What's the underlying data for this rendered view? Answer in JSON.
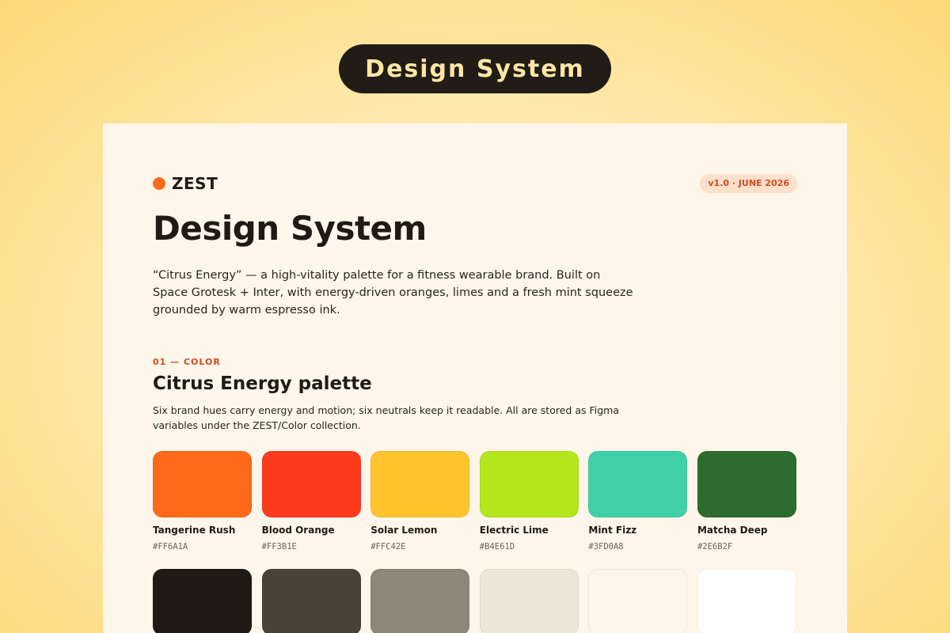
{
  "header_pill": {
    "label": "Design System"
  },
  "brand": {
    "name": "ZEST",
    "dot_color": "#FF6A1A"
  },
  "version_badge": "v1.0 · JUNE 2026",
  "page_title": "Design System",
  "description": "“Citrus Energy” — a high-vitality palette for a fitness wearable brand. Built on Space Grotesk + Inter, with energy-driven oranges, limes and a fresh mint squeeze grounded by warm espresso ink.",
  "section": {
    "label": "01 — COLOR",
    "title": "Citrus Energy palette",
    "description": "Six brand hues carry energy and motion; six neutrals keep it readable. All are stored as Figma variables under the ZEST/Color collection."
  },
  "brand_swatches": [
    {
      "name": "Tangerine Rush",
      "hex": "#FF6A1A"
    },
    {
      "name": "Blood Orange",
      "hex": "#FF3B1E"
    },
    {
      "name": "Solar Lemon",
      "hex": "#FFC42E"
    },
    {
      "name": "Electric Lime",
      "hex": "#B4E61D"
    },
    {
      "name": "Mint Fizz",
      "hex": "#3FD0A8"
    },
    {
      "name": "Matcha Deep",
      "hex": "#2E6B2F"
    }
  ],
  "neutral_swatches": [
    {
      "color": "#1F1A14"
    },
    {
      "color": "#4A4236"
    },
    {
      "color": "#8E8778"
    },
    {
      "color": "#EFE6D8"
    },
    {
      "color": "#FEF6EA"
    },
    {
      "color": "#FFFFFF"
    }
  ]
}
